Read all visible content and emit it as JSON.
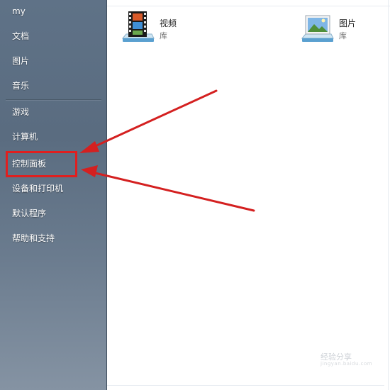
{
  "sidebar": {
    "items": [
      {
        "label": "my"
      },
      {
        "label": "文档"
      },
      {
        "label": "图片"
      },
      {
        "label": "音乐"
      },
      {
        "label": "游戏"
      },
      {
        "label": "计算机"
      },
      {
        "label": "控制面板"
      },
      {
        "label": "设备和打印机"
      },
      {
        "label": "默认程序"
      },
      {
        "label": "帮助和支持"
      }
    ]
  },
  "libraries": [
    {
      "name": "视频",
      "type": "库",
      "icon": "video-library-icon"
    },
    {
      "name": "图片",
      "type": "库",
      "icon": "pictures-library-icon"
    }
  ],
  "annotations": {
    "highlight_color": "#e01f1f",
    "arrow_color": "#d42020"
  },
  "watermark": {
    "text": "经验分享",
    "sub": "jingyan.baidu.com"
  }
}
